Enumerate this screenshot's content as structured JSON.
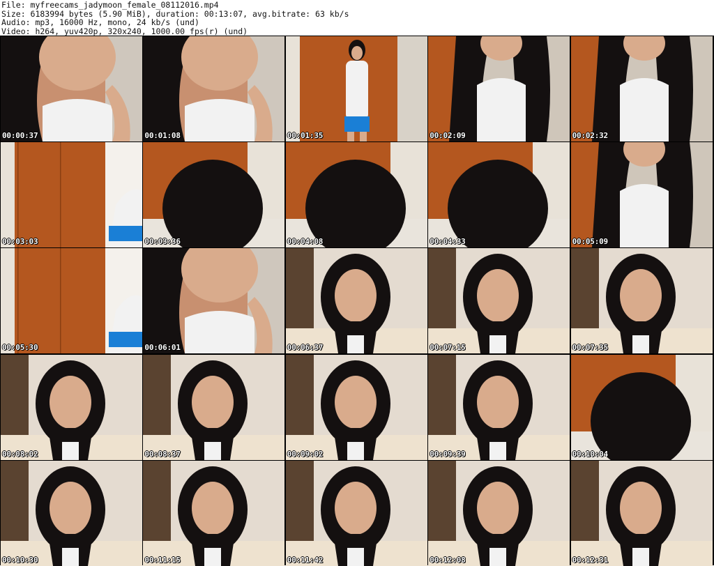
{
  "header": {
    "file": "File: myfreecams_jadymoon_female_08112016.mp4",
    "size": "Size: 6183994 bytes (5.90 MiB), duration: 00:13:07, avg.bitrate: 63 kb/s",
    "audio": "Audio: mp3, 16000 Hz, mono, 24 kb/s (und)",
    "video": "Video: h264, yuv420p, 320x240, 1000.00 fps(r) (und)"
  },
  "thumbnails": [
    {
      "time": "00:00:37",
      "scene": "closeup"
    },
    {
      "time": "00:01:08",
      "scene": "closeup"
    },
    {
      "time": "00:01:35",
      "scene": "standing"
    },
    {
      "time": "00:02:09",
      "scene": "torso"
    },
    {
      "time": "00:02:32",
      "scene": "torso"
    },
    {
      "time": "00:03:03",
      "scene": "door"
    },
    {
      "time": "00:03:36",
      "scene": "hairtop"
    },
    {
      "time": "00:04:08",
      "scene": "hairtop"
    },
    {
      "time": "00:04:33",
      "scene": "hairtop"
    },
    {
      "time": "00:05:09",
      "scene": "torso"
    },
    {
      "time": "00:05:30",
      "scene": "door"
    },
    {
      "time": "00:06:01",
      "scene": "closeup"
    },
    {
      "time": "00:06:37",
      "scene": "face"
    },
    {
      "time": "00:07:15",
      "scene": "face"
    },
    {
      "time": "00:07:35",
      "scene": "face"
    },
    {
      "time": "00:08:02",
      "scene": "face"
    },
    {
      "time": "00:08:37",
      "scene": "face"
    },
    {
      "time": "00:09:02",
      "scene": "face"
    },
    {
      "time": "00:09:39",
      "scene": "face"
    },
    {
      "time": "00:10:04",
      "scene": "hairtop"
    },
    {
      "time": "00:10:30",
      "scene": "face"
    },
    {
      "time": "00:11:15",
      "scene": "face"
    },
    {
      "time": "00:11:42",
      "scene": "face"
    },
    {
      "time": "00:12:08",
      "scene": "face"
    },
    {
      "time": "00:12:31",
      "scene": "face"
    }
  ],
  "colors": {
    "door": "#b4571f",
    "wall": "#e8e2d8",
    "curtain": "#5a4330",
    "hair": "#141010",
    "skin": "#d9ab8c",
    "shirt": "#f2f2f2",
    "shorts": "#1a7fd6"
  }
}
